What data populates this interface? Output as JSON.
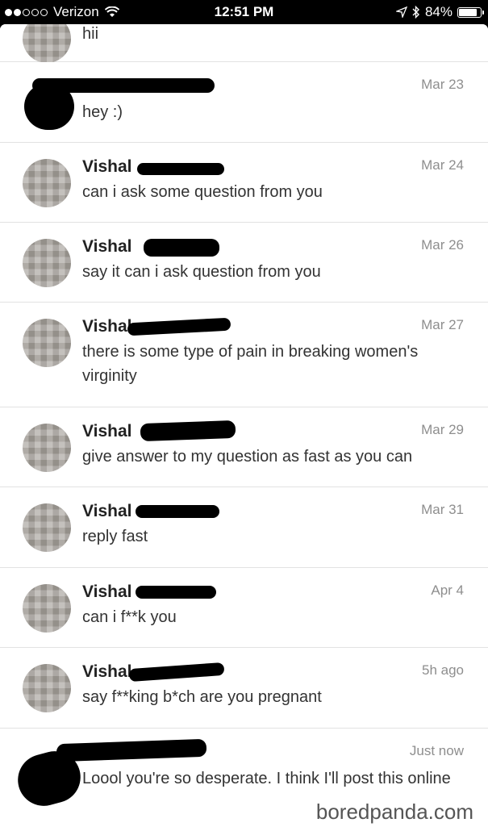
{
  "status_bar": {
    "carrier": "Verizon",
    "time": "12:51 PM",
    "battery": "84%",
    "battery_level": 0.84
  },
  "messages": [
    {
      "sender": "",
      "text": "hii",
      "date": ""
    },
    {
      "sender": "",
      "text": "hey :)",
      "date": "Mar 23"
    },
    {
      "sender": "Vishal",
      "text": "can i ask some question from you",
      "date": "Mar 24"
    },
    {
      "sender": "Vishal",
      "text": "say it can i ask question from you",
      "date": "Mar 26"
    },
    {
      "sender": "Vishal",
      "text": "there is some type of pain in breaking women's virginity",
      "date": "Mar 27"
    },
    {
      "sender": "Vishal",
      "text": "give answer to my question as fast as you can",
      "date": "Mar 29"
    },
    {
      "sender": "Vishal",
      "text": "reply fast",
      "date": "Mar 31"
    },
    {
      "sender": "Vishal",
      "text": "can i f**k you",
      "date": "Apr 4"
    },
    {
      "sender": "Vishal",
      "text": "say f**king b*ch are you pregnant",
      "date": "5h ago"
    },
    {
      "sender": "",
      "text": "Loool you're so desperate. I think I'll post this online",
      "date": "Just now"
    }
  ],
  "watermark": "boredpanda.com"
}
